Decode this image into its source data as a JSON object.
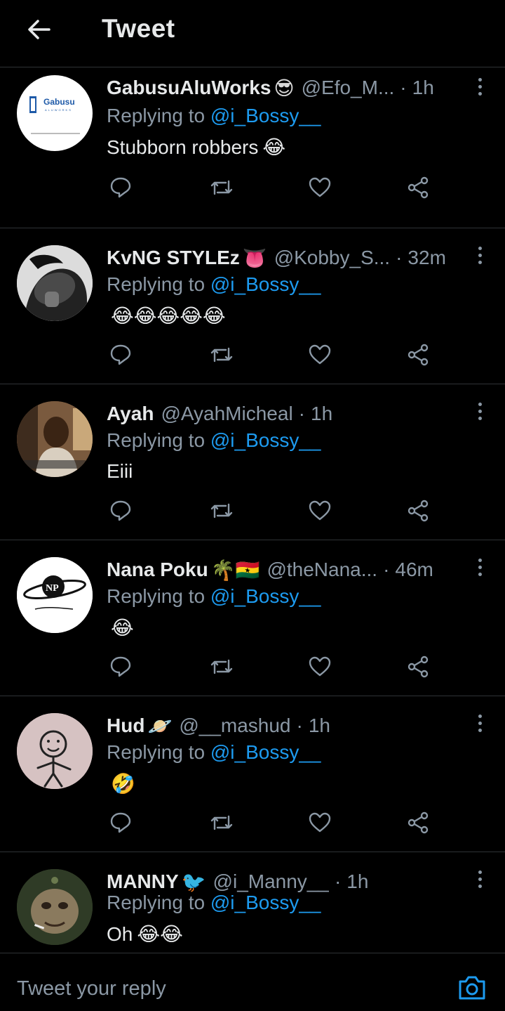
{
  "header": {
    "title": "Tweet",
    "back_icon": "arrow-left-icon"
  },
  "replying_label": "Replying to",
  "replying_mention": "@i_Bossy__",
  "colors": {
    "accent": "#1d9bf0",
    "muted": "#8b98a5",
    "background": "#000000",
    "divider": "#2f3336"
  },
  "tweets": [
    {
      "name": "GabusuAluWorks",
      "emoji": "😎",
      "handle": "@Efo_M...",
      "time": "1h",
      "text": "Stubborn robbers",
      "text_emoji": "😂",
      "avatar_logo": "Gabusu",
      "avatar_sub": "ALUWORKS"
    },
    {
      "name": "KvNG STYLEz",
      "emoji": "👅",
      "handle": "@Kobby_S...",
      "time": "32m",
      "text": "",
      "text_emoji": "😂😂😂😂😂"
    },
    {
      "name": "Ayah",
      "emoji": "",
      "handle": "@AyahMicheal",
      "time": "1h",
      "text": "Eiii",
      "text_emoji": ""
    },
    {
      "name": "Nana Poku",
      "emoji": "🌴🇬🇭",
      "handle": "@theNana...",
      "time": "46m",
      "text": "",
      "text_emoji": "😂",
      "avatar_logo": "NP"
    },
    {
      "name": "Hud",
      "emoji": "🪐",
      "handle": "@__mashud",
      "time": "1h",
      "text": "",
      "text_emoji": "🤣"
    },
    {
      "name": "MANNY",
      "emoji": "🐦",
      "handle": "@i_Manny__",
      "time": "1h",
      "text": "Oh",
      "text_emoji": "😂😂"
    }
  ],
  "composer": {
    "placeholder": "Tweet your reply",
    "camera_icon": "camera-icon"
  }
}
